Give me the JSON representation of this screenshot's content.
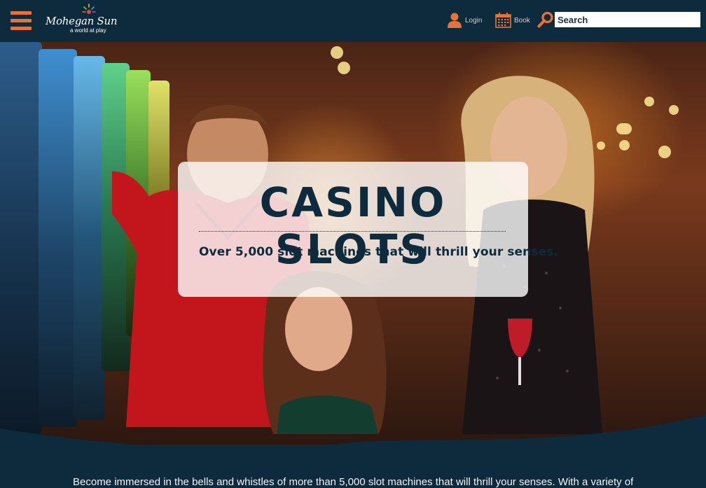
{
  "header": {
    "logo_brand": "Mohegan Sun",
    "logo_tagline": "a world at play",
    "nav": {
      "login_label": "Login",
      "book_label": "Book"
    },
    "search": {
      "placeholder": "Search"
    },
    "icons": {
      "menu": "hamburger-menu-icon",
      "login": "user-icon",
      "book": "calendar-icon",
      "search": "magnifier-icon"
    }
  },
  "hero": {
    "title": "CASINO SLOTS",
    "subtitle": "Over 5,000 slot machines that will thrill your senses."
  },
  "intro": {
    "text": "Become immersed in the bells and whistles of more than 5,000 slot machines that will thrill your senses. With a variety of"
  },
  "colors": {
    "header_bg": "#0e2a3d",
    "accent_orange": "#e8733a",
    "panel_bg": "rgba(255,255,255,0.8)",
    "title_text": "#0e2a3d"
  }
}
